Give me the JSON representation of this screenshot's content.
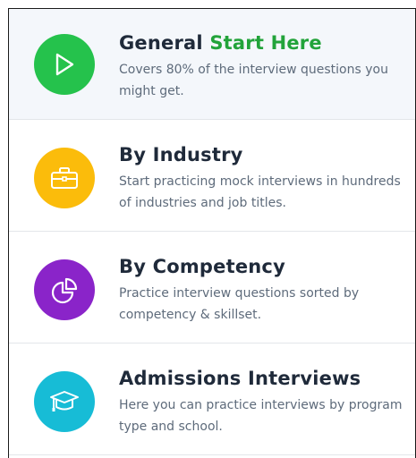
{
  "colors": {
    "green": "#25c24c",
    "yellow": "#fbbc0b",
    "purple": "#8a24c9",
    "cyan": "#17bcd6",
    "title_text": "#1f2a3a",
    "accent_text": "#22a33a",
    "desc_text": "#5e6b7b"
  },
  "items": [
    {
      "title": "General",
      "title_accent": "Start Here",
      "description": "Covers 80% of the interview questions you might get.",
      "icon": "play-icon"
    },
    {
      "title": "By Industry",
      "description": "Start practicing mock interviews in hundreds of industries and job titles.",
      "icon": "briefcase-icon"
    },
    {
      "title": "By Competency",
      "description": "Practice interview questions sorted by competency & skillset.",
      "icon": "pie-chart-icon"
    },
    {
      "title": "Admissions Interviews",
      "description": "Here you can practice interviews by program type and school.",
      "icon": "graduation-cap-icon"
    }
  ]
}
